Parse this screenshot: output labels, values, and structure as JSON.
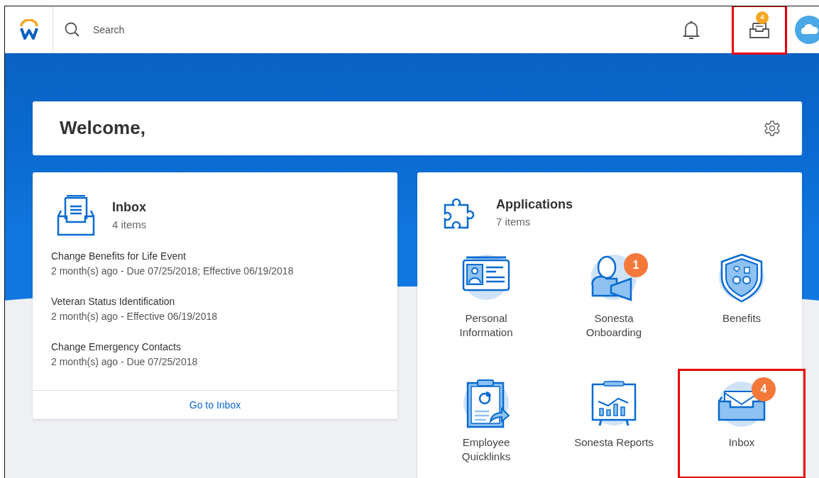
{
  "header": {
    "search": {
      "placeholder": "Search"
    },
    "inbox_badge": "4",
    "inbox_highlighted": true
  },
  "welcome": {
    "title": "Welcome,"
  },
  "inbox_card": {
    "title": "Inbox",
    "count": "4 items",
    "items": [
      {
        "title": "Change Benefits for Life Event",
        "detail": "2 month(s) ago - Due 07/25/2018; Effective 06/19/2018"
      },
      {
        "title": "Veteran Status Identification",
        "detail": "2 month(s) ago - Effective 06/19/2018"
      },
      {
        "title": "Change Emergency Contacts",
        "detail": "2 month(s) ago - Due 07/25/2018"
      }
    ],
    "link": "Go to Inbox"
  },
  "applications": {
    "title": "Applications",
    "count": "7 items",
    "apps": [
      {
        "kind": "idcard",
        "label": "Personal Information",
        "highlighted": false
      },
      {
        "kind": "megaphone",
        "label": "Sonesta Onboarding",
        "badge": "1",
        "highlighted": false
      },
      {
        "kind": "shield",
        "label": "Benefits",
        "highlighted": false
      },
      {
        "kind": "clipboard",
        "label": "Employee Quicklinks",
        "highlighted": false
      },
      {
        "kind": "easel",
        "label": "Sonesta Reports",
        "highlighted": false
      },
      {
        "kind": "tray",
        "label": "Inbox",
        "badge": "4",
        "highlighted": true
      }
    ]
  }
}
